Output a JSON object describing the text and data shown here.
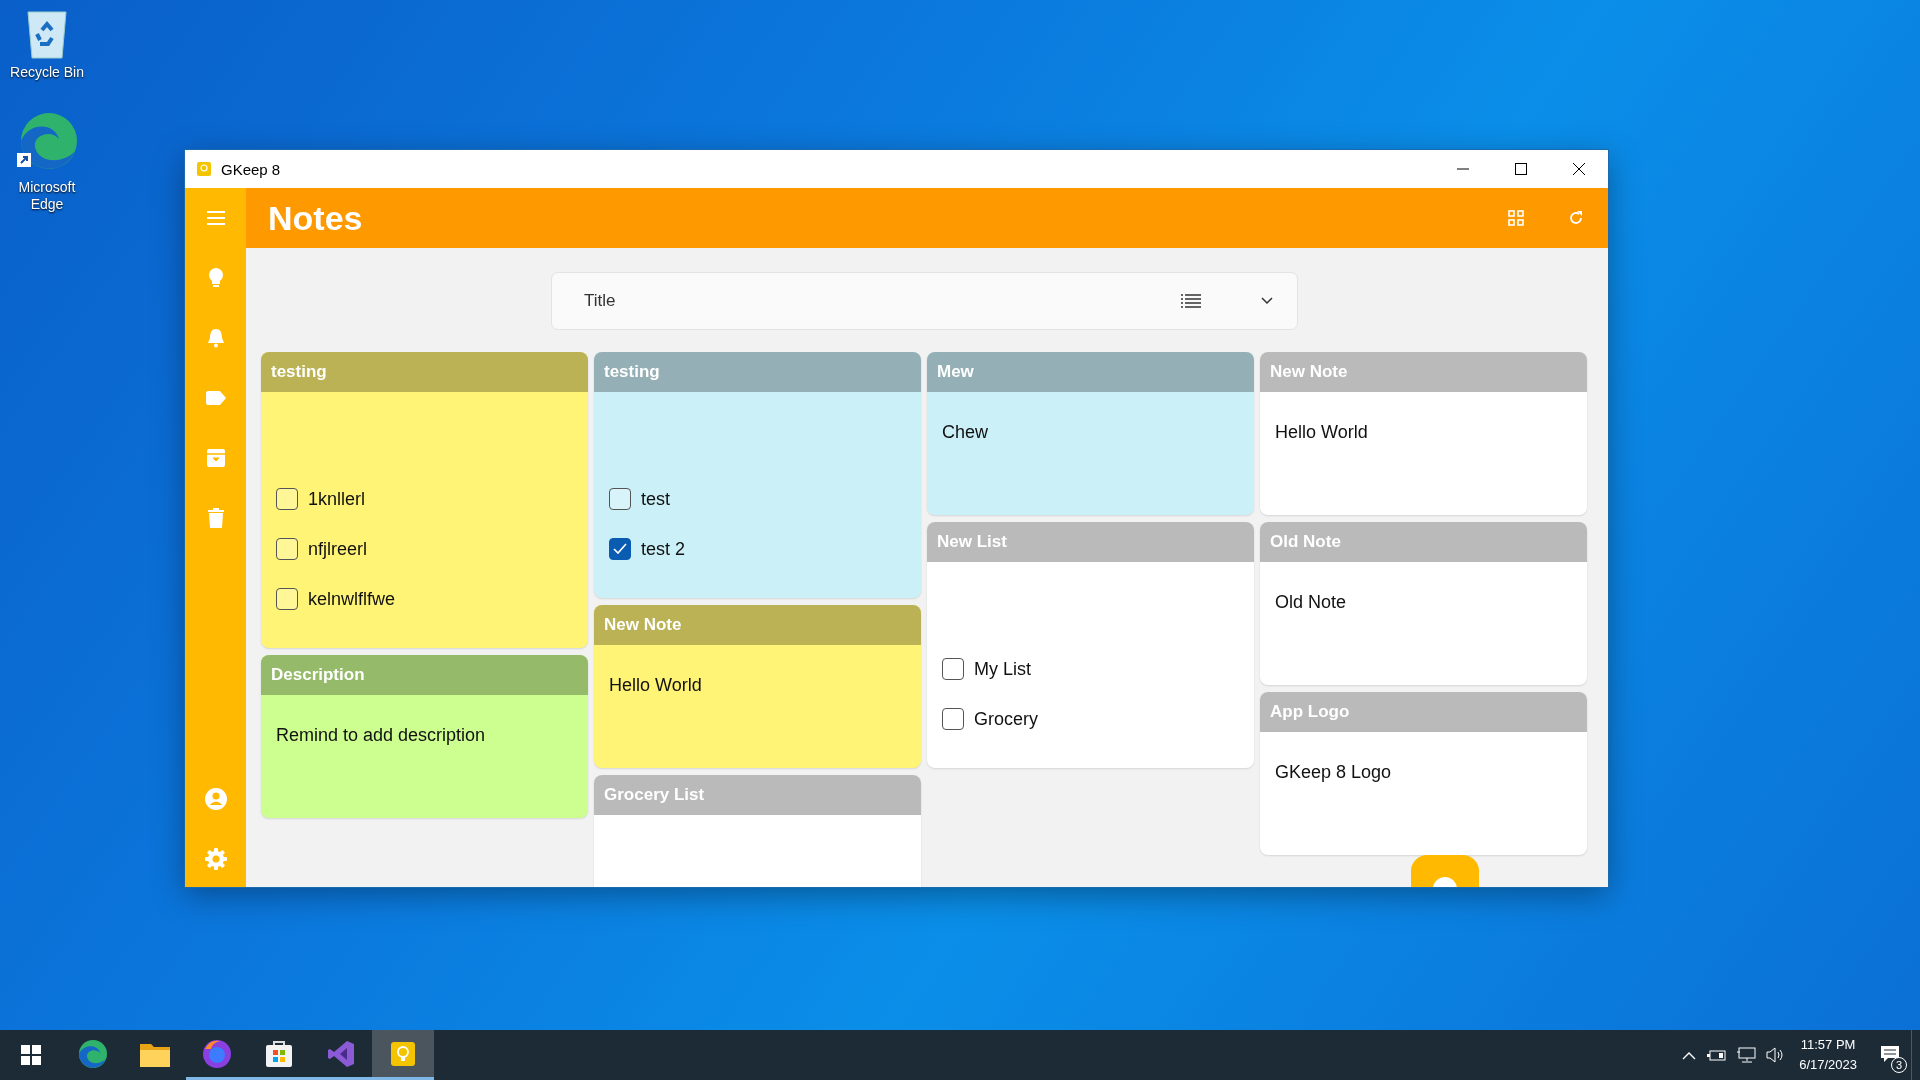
{
  "desktop_icons": [
    {
      "label": "Recycle Bin",
      "kind": "recycle"
    },
    {
      "label": "Microsoft Edge",
      "kind": "edge"
    }
  ],
  "window": {
    "title": "GKeep 8"
  },
  "header": {
    "title": "Notes"
  },
  "sort": {
    "value": "Title"
  },
  "columns": [
    [
      {
        "title": "testing",
        "color": "#fff475",
        "kind": "list",
        "items": [
          {
            "text": "1knllerl",
            "checked": false
          },
          {
            "text": "nfjlreerl",
            "checked": false
          },
          {
            "text": "kelnwlflfwe",
            "checked": false
          }
        ]
      },
      {
        "title": "Description",
        "color": "#ccff90",
        "kind": "text",
        "body": "Remind to add description"
      }
    ],
    [
      {
        "title": "testing",
        "color": "#cbf0f8",
        "kind": "list",
        "items": [
          {
            "text": "test",
            "checked": false
          },
          {
            "text": "test 2",
            "checked": true
          }
        ]
      },
      {
        "title": "New Note",
        "color": "#fff475",
        "kind": "text",
        "body": "Hello World"
      },
      {
        "title": "Grocery List",
        "color": "#ffffff",
        "kind": "text"
      }
    ],
    [
      {
        "title": "Mew",
        "color": "#cbf0f8",
        "kind": "text",
        "body": "Chew"
      },
      {
        "title": "New List",
        "color": "#ffffff",
        "kind": "list",
        "items": [
          {
            "text": "My List",
            "checked": false
          },
          {
            "text": "Grocery",
            "checked": false
          }
        ]
      }
    ],
    [
      {
        "title": "New Note",
        "color": "#ffffff",
        "kind": "text",
        "body": "Hello World"
      },
      {
        "title": "Old Note",
        "color": "#ffffff",
        "kind": "text",
        "body": "Old Note"
      },
      {
        "title": "App Logo",
        "color": "#ffffff",
        "kind": "text",
        "body": "GKeep 8 Logo"
      }
    ]
  ],
  "taskbar": {
    "apps": [
      {
        "kind": "edge",
        "running": false,
        "selected": false
      },
      {
        "kind": "folder",
        "running": false,
        "selected": false
      },
      {
        "kind": "firefox",
        "running": true,
        "selected": false
      },
      {
        "kind": "store",
        "running": true,
        "selected": false
      },
      {
        "kind": "studio",
        "running": true,
        "selected": false
      },
      {
        "kind": "gkeep",
        "running": true,
        "selected": true
      }
    ],
    "time": "11:57 PM",
    "date": "6/17/2023",
    "notifications": "3"
  }
}
